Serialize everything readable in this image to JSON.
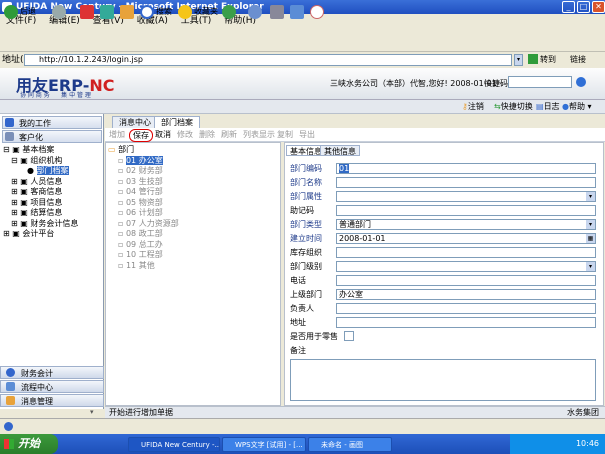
{
  "window": {
    "title": "UFIDA New Century - Microsoft Internet Explorer",
    "min": "_",
    "max": "□",
    "close": "✕"
  },
  "menu": [
    "文件(F)",
    "编辑(E)",
    "查看(V)",
    "收藏(A)",
    "工具(T)",
    "帮助(H)"
  ],
  "toolbar": {
    "back": "后退",
    "search": "搜索",
    "favorites": "收藏夹"
  },
  "address": {
    "label": "地址(D)",
    "url": "http://10.1.2.243/login.jsp",
    "go": "转到",
    "links": "链接"
  },
  "header": {
    "logo_main": "用友ERP-",
    "logo_nc": "NC",
    "logo_tagline": "协 同 商 务      集 中 管 理",
    "user_info": "三峡水务公司（本部）代智,您好! 2008-01-01",
    "quick_code_label": "快捷码"
  },
  "subbar": {
    "logout": "注销",
    "quick_switch": "快捷切换",
    "log": "日志",
    "help": "帮助"
  },
  "leftnav": {
    "sections": [
      "我的工作",
      "客户化"
    ],
    "tree": [
      {
        "label": "基本档案",
        "level": 0,
        "toggle": "⊟"
      },
      {
        "label": "组织机构",
        "level": 1,
        "toggle": "⊟"
      },
      {
        "label": "部门档案",
        "level": 2,
        "toggle": ""
      },
      {
        "label": "人员信息",
        "level": 1,
        "toggle": "⊞"
      },
      {
        "label": "客商信息",
        "level": 1,
        "toggle": "⊞"
      },
      {
        "label": "项目信息",
        "level": 1,
        "toggle": "⊞"
      },
      {
        "label": "结算信息",
        "level": 1,
        "toggle": "⊞"
      },
      {
        "label": "财务会计信息",
        "level": 1,
        "toggle": "⊞"
      },
      {
        "label": "会计平台",
        "level": 0,
        "toggle": "⊞"
      }
    ],
    "bottom": [
      "财务会计",
      "流程中心",
      "消息管理"
    ]
  },
  "tabs": [
    "消息中心",
    "部门档案"
  ],
  "actions": {
    "add": "增加",
    "save": "保存",
    "cancel": "取消",
    "edit": "修改",
    "delete": "删除",
    "refresh": "刷新",
    "list": "列表显示",
    "copy": "复制",
    "export": "导出"
  },
  "dept_tree": {
    "root": "部门",
    "items": [
      "01 办公室",
      "02 财务部",
      "03 生技部",
      "04 管行部",
      "05 物资部",
      "06 计划部",
      "07 人力资源部",
      "08 政工部",
      "09 总工办",
      "10 工程部",
      "11 其他"
    ]
  },
  "form": {
    "tabs": [
      "基本信息",
      "其他信息"
    ],
    "fields": [
      {
        "label": "部门编码",
        "value": "01",
        "required": true,
        "dropdown": false
      },
      {
        "label": "部门名称",
        "value": "",
        "required": true,
        "dropdown": false
      },
      {
        "label": "部门属性",
        "value": "",
        "required": true,
        "dropdown": true
      },
      {
        "label": "助记码",
        "value": "",
        "required": false,
        "dropdown": false
      },
      {
        "label": "部门类型",
        "value": "普通部门",
        "required": true,
        "dropdown": true
      },
      {
        "label": "建立时间",
        "value": "2008-01-01",
        "required": true,
        "dropdown": true
      },
      {
        "label": "库存组织",
        "value": "",
        "required": false,
        "dropdown": false
      },
      {
        "label": "部门级别",
        "value": "",
        "required": false,
        "dropdown": true
      },
      {
        "label": "电话",
        "value": "",
        "required": false,
        "dropdown": false
      },
      {
        "label": "上级部门",
        "value": "办公室",
        "required": false,
        "dropdown": false
      },
      {
        "label": "负责人",
        "value": "",
        "required": false,
        "dropdown": false
      },
      {
        "label": "地址",
        "value": "",
        "required": false,
        "dropdown": false
      }
    ],
    "retail_label": "是否用于零售",
    "remark_label": "备注"
  },
  "status": {
    "left": "开始进行增加单据",
    "right": "水务集团"
  },
  "taskbar": {
    "start": "开始",
    "tasks": [
      "UFIDA New Century -...",
      "WPS文字 [试用] - [...",
      "未命名 - 画图"
    ],
    "time": "10:46"
  }
}
